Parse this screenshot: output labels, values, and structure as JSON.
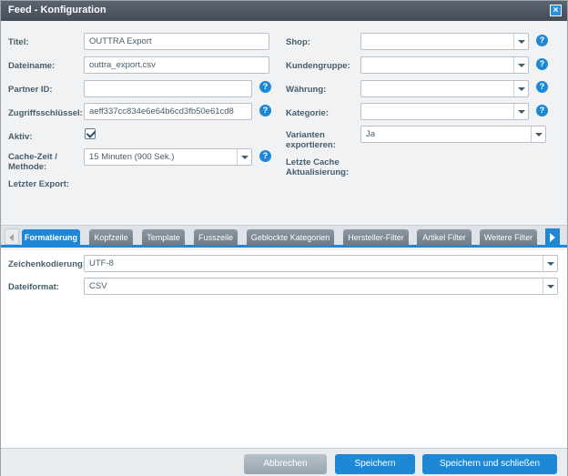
{
  "window": {
    "title": "Feed - Konfiguration"
  },
  "form": {
    "title_label": "Titel:",
    "title_value": "OUTTRA Export",
    "filename_label": "Dateiname:",
    "filename_value": "outtra_export.csv",
    "partner_label": "Partner ID:",
    "partner_value": "",
    "key_label": "Zugriffsschlüssel:",
    "key_value": "aeff337cc834e6e64b6cd3fb50e61cd8",
    "active_label": "Aktiv:",
    "active_checked": true,
    "cache_label_1": "Cache-Zeit /",
    "cache_label_2": "Methode:",
    "cache_value": "15 Minuten (900 Sek.)",
    "last_export_label": "Letzter Export:",
    "shop_label": "Shop:",
    "shop_value": "",
    "customergroup_label": "Kundengruppe:",
    "customergroup_value": "",
    "currency_label": "Währung:",
    "currency_value": "",
    "category_label": "Kategorie:",
    "category_value": "",
    "variants_label_1": "Varianten",
    "variants_label_2": "exportieren:",
    "variants_value": "Ja",
    "lastcache_label_1": "Letzte Cache",
    "lastcache_label_2": "Aktualisierung:",
    "help_glyph": "?"
  },
  "tabs": {
    "items": [
      {
        "label": "Formatierung",
        "active": true
      },
      {
        "label": "Kopfzeile"
      },
      {
        "label": "Template"
      },
      {
        "label": "Fusszeile"
      },
      {
        "label": "Geblockte Kategorien"
      },
      {
        "label": "Hersteller-Filter"
      },
      {
        "label": "Artikel Filter"
      },
      {
        "label": "Weitere Filter"
      }
    ]
  },
  "formatting": {
    "encoding_label": "Zeichenkodierung:",
    "encoding_value": "UTF-8",
    "format_label": "Dateiformat:",
    "format_value": "CSV"
  },
  "footer": {
    "cancel": "Abbrechen",
    "save": "Speichern",
    "save_close": "Speichern und schließen"
  },
  "colors": {
    "accent": "#1e88d6",
    "titlebar": "#4f5863",
    "tab_inactive": "#7b8792"
  },
  "icons": [
    "close-icon",
    "help-icon",
    "checkbox-checked-icon",
    "arrow-left-icon",
    "arrow-right-icon",
    "chevron-down-icon"
  ]
}
